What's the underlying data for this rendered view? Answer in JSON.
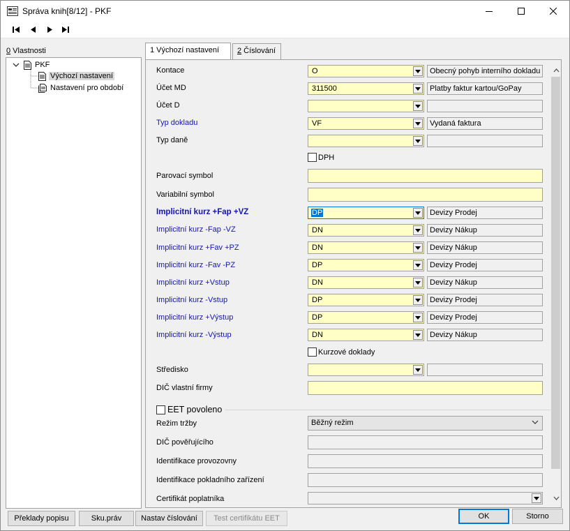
{
  "window": {
    "title": "Správa knih[8/12] - PKF"
  },
  "left": {
    "label_prefix": "0",
    "label_rest": " Vlastnosti",
    "tree": {
      "root": "PKF",
      "children": [
        "Výchozí nastavení",
        "Nastavení pro období"
      ]
    }
  },
  "tabs": [
    {
      "label": "1 Výchozí nastavení"
    },
    {
      "prefix": "2",
      "rest": " Číslování"
    }
  ],
  "form": {
    "kontace": {
      "label": "Kontace",
      "value": "O",
      "desc": "Obecný pohyb interního dokladu"
    },
    "ucet_md": {
      "label": "Účet MD",
      "value": "311500",
      "desc": "Platby faktur kartou/GoPay"
    },
    "ucet_d": {
      "label": "Účet D",
      "value": "",
      "desc": ""
    },
    "typ_dokladu": {
      "label": "Typ dokladu",
      "value": "VF",
      "desc": "Vydaná faktura"
    },
    "typ_dane": {
      "label": "Typ daně",
      "value": "",
      "desc": ""
    },
    "dph_label": "DPH",
    "parovaci_symbol": {
      "label": "Parovací symbol",
      "value": ""
    },
    "variabilni_symbol": {
      "label": "Variabilní symbol",
      "value": ""
    },
    "kurzy": [
      {
        "label": "Implicitní kurz +Fap +VZ",
        "value": "DP",
        "desc": "Devizy Prodej"
      },
      {
        "label": "Implicitní kurz -Fap -VZ",
        "value": "DN",
        "desc": "Devizy Nákup"
      },
      {
        "label": "Implicitní kurz +Fav +PZ",
        "value": "DN",
        "desc": "Devizy Nákup"
      },
      {
        "label": "Implicitní kurz -Fav -PZ",
        "value": "DP",
        "desc": "Devizy Prodej"
      },
      {
        "label": "Implicitní kurz +Vstup",
        "value": "DN",
        "desc": "Devizy Nákup"
      },
      {
        "label": "Implicitní kurz -Vstup",
        "value": "DP",
        "desc": "Devizy Prodej"
      },
      {
        "label": "Implicitní kurz +Výstup",
        "value": "DP",
        "desc": "Devizy Prodej"
      },
      {
        "label": "Implicitní kurz -Výstup",
        "value": "DN",
        "desc": "Devizy Nákup"
      }
    ],
    "kurzove_doklady_label": "Kurzové doklady",
    "stredisko": {
      "label": "Středisko",
      "value": "",
      "desc": ""
    },
    "dic_firmy": {
      "label": "DIČ vlastní firmy",
      "value": ""
    },
    "eet": {
      "label": "EET povoleno",
      "rezim_label": "Režim tržby",
      "rezim_value": "Běžný režim",
      "dic_poverujiciho_label": "DIČ pověřujícího",
      "id_provozovny_label": "Identifikace provozovny",
      "id_zarizeni_label": "Identifikace pokladního zařízení",
      "certifikat_label": "Certifikát poplatníka"
    }
  },
  "buttons": {
    "preklady": "Překlady popisu",
    "sku_prav": "Sku.práv",
    "nastav_cislovani": "Nastav číslování",
    "test_certifikatu": "Test certifikátu EET",
    "ok": "OK",
    "storno": "Storno"
  },
  "colors": {
    "field_bg": "#ffffc6",
    "label_blue": "#1414b4",
    "selection": "#0078d7"
  }
}
